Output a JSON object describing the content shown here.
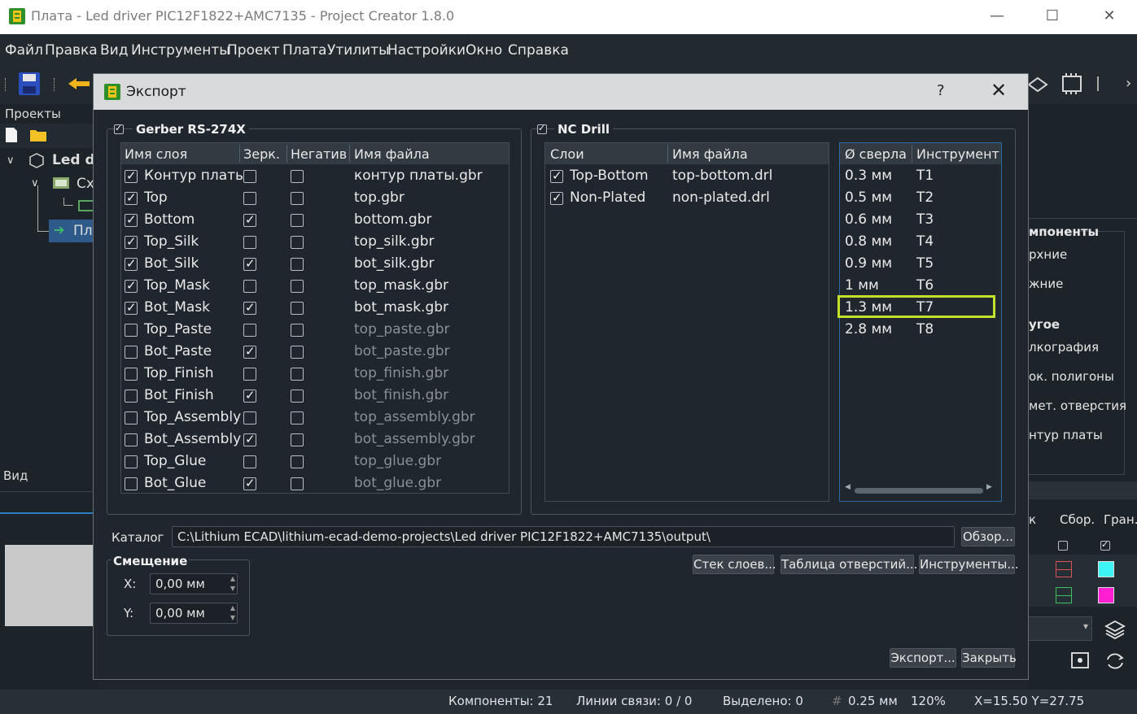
{
  "window": {
    "title": "Плата - Led driver PIC12F1822+AMC7135 - Project Creator 1.8.0"
  },
  "menu": [
    "Файл",
    "Правка",
    "Вид",
    "Инструменты",
    "Проект",
    "Плата",
    "Утилиты",
    "Настройки",
    "Окно",
    "Справка"
  ],
  "left_panel": {
    "projects_label": "Проекты",
    "tree": [
      {
        "label": "Led dr"
      },
      {
        "label": "Сх"
      },
      {
        "label": "Пл"
      }
    ],
    "view_label": "Вид"
  },
  "right_panel": {
    "components_heading": "мпоненты",
    "upper": "рхние",
    "lower": "жние",
    "other_heading": "угое",
    "silk": "лкография",
    "polygons": "ок. полигоны",
    "holes": "мет. отверстия",
    "outline": "нтур платы",
    "col_k": "к",
    "col_assembly": "Сбор.",
    "col_border": "Гран."
  },
  "dialog": {
    "title": "Экспорт",
    "help": "?",
    "close": "✕",
    "gerber": {
      "title": "Gerber RS-274X",
      "checked": true,
      "headers": [
        "Имя слоя",
        "Зерк.",
        "Негатив",
        "Имя файла"
      ],
      "rows": [
        {
          "layer": "Контур платы",
          "on": true,
          "mirror": false,
          "negative": false,
          "file": "контур платы.gbr"
        },
        {
          "layer": "Top",
          "on": true,
          "mirror": false,
          "negative": false,
          "file": "top.gbr"
        },
        {
          "layer": "Bottom",
          "on": true,
          "mirror": true,
          "negative": false,
          "file": "bottom.gbr"
        },
        {
          "layer": "Top_Silk",
          "on": true,
          "mirror": false,
          "negative": false,
          "file": "top_silk.gbr"
        },
        {
          "layer": "Bot_Silk",
          "on": true,
          "mirror": true,
          "negative": false,
          "file": "bot_silk.gbr"
        },
        {
          "layer": "Top_Mask",
          "on": true,
          "mirror": false,
          "negative": false,
          "file": "top_mask.gbr"
        },
        {
          "layer": "Bot_Mask",
          "on": true,
          "mirror": true,
          "negative": false,
          "file": "bot_mask.gbr"
        },
        {
          "layer": "Top_Paste",
          "on": false,
          "mirror": false,
          "negative": false,
          "file": "top_paste.gbr"
        },
        {
          "layer": "Bot_Paste",
          "on": false,
          "mirror": true,
          "negative": false,
          "file": "bot_paste.gbr"
        },
        {
          "layer": "Top_Finish",
          "on": false,
          "mirror": false,
          "negative": false,
          "file": "top_finish.gbr"
        },
        {
          "layer": "Bot_Finish",
          "on": false,
          "mirror": true,
          "negative": false,
          "file": "bot_finish.gbr"
        },
        {
          "layer": "Top_Assembly",
          "on": false,
          "mirror": false,
          "negative": false,
          "file": "top_assembly.gbr"
        },
        {
          "layer": "Bot_Assembly",
          "on": false,
          "mirror": true,
          "negative": false,
          "file": "bot_assembly.gbr"
        },
        {
          "layer": "Top_Glue",
          "on": false,
          "mirror": false,
          "negative": false,
          "file": "top_glue.gbr"
        },
        {
          "layer": "Bot_Glue",
          "on": false,
          "mirror": true,
          "negative": false,
          "file": "bot_glue.gbr"
        }
      ]
    },
    "nc_drill": {
      "title": "NC Drill",
      "checked": true,
      "headers": [
        "Слои",
        "Имя файла"
      ],
      "rows": [
        {
          "layer": "Top-Bottom",
          "on": true,
          "file": "top-bottom.drl"
        },
        {
          "layer": "Non-Plated",
          "on": true,
          "file": "non-plated.drl"
        }
      ],
      "tool_headers": [
        "Ø сверла",
        "Инструмент"
      ],
      "tools": [
        {
          "dia": "0.3 мм",
          "tool": "T1"
        },
        {
          "dia": "0.5 мм",
          "tool": "T2"
        },
        {
          "dia": "0.6 мм",
          "tool": "T3"
        },
        {
          "dia": "0.8 мм",
          "tool": "T4"
        },
        {
          "dia": "0.9 мм",
          "tool": "T5"
        },
        {
          "dia": "1 мм",
          "tool": "T6"
        },
        {
          "dia": "1.3 мм",
          "tool": "T7"
        },
        {
          "dia": "2.8 мм",
          "tool": "T8"
        }
      ]
    },
    "catalog_label": "Каталог",
    "catalog_path": "C:\\Lithium ECAD\\lithium-ecad-demo-projects\\Led driver PIC12F1822+AMC7135\\output\\",
    "browse": "Обзор...",
    "stack": "Стек слоев...",
    "hole_table": "Таблица отверстий...",
    "tools_btn": "Инструменты...",
    "offset": {
      "title": "Смещение",
      "x_label": "X:",
      "x_value": "0,00 мм",
      "y_label": "Y:",
      "y_value": "0,00 мм"
    },
    "export_btn": "Экспорт...",
    "close_btn": "Закрыть"
  },
  "status": {
    "components": "Компоненты: 21",
    "links": "Линии связи: 0 / 0",
    "selected": "Выделено: 0",
    "grid": "0.25 мм",
    "zoom": "120%",
    "coords": "X=15.50  Y=27.75"
  },
  "colors": {
    "highlight": "#c3e02a",
    "cyan": "#3ef4f4",
    "magenta": "#ff1fd2"
  }
}
